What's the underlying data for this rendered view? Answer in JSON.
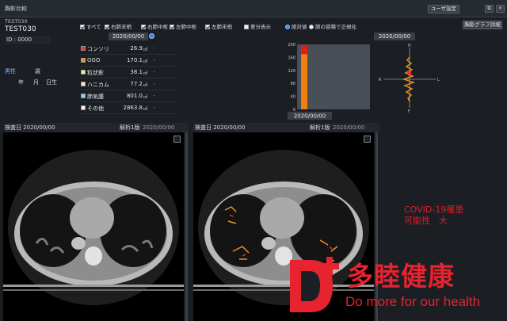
{
  "window": {
    "title": "胸影比較",
    "user_settings_label": "ユーザ設定",
    "restore_glyph": "⧉",
    "close_glyph": "×"
  },
  "patient": {
    "code": "TEST030",
    "name": "TEST030",
    "id_label": "ID : 0000",
    "sex": "男性",
    "age_unit": "歳",
    "year_unit": "年",
    "month_unit": "月",
    "day_unit": "日生"
  },
  "filters": {
    "all": "すべて",
    "right_lower": "右肺末梢",
    "right_middle": "右肺中枢",
    "left_middle": "左肺中枢",
    "left_lower": "左肺末梢",
    "diff_display": "差分表示",
    "absolute": "絶対値",
    "normalize": "肺の容積で正規化"
  },
  "detail_graph_label": "胸影グラフ詳細",
  "left_panel": {
    "date": "2020/00/00"
  },
  "right_panel": {
    "date": "2020/00/00"
  },
  "findings": [
    {
      "label": "コンソリ",
      "value": "26.9",
      "unit": "㎤",
      "compare": "-",
      "color": "#e8322a"
    },
    {
      "label": "GGO",
      "value": "170.1",
      "unit": "㎤",
      "compare": "-",
      "color": "#f09020"
    },
    {
      "label": "粒状影",
      "value": "38.1",
      "unit": "㎤",
      "compare": "-",
      "color": "#f6ef8c"
    },
    {
      "label": "ハニカム",
      "value": "77.2",
      "unit": "㎤",
      "compare": "-",
      "color": "#f4f2c0"
    },
    {
      "label": "肺気腫",
      "value": "801.0",
      "unit": "㎤",
      "compare": "-",
      "color": "#86d4ea"
    },
    {
      "label": "その他",
      "value": "2863.8",
      "unit": "㎤",
      "compare": "-",
      "color": "#f2f2f2"
    }
  ],
  "chart_data": {
    "type": "bar",
    "categories": [
      "2020/00/00"
    ],
    "series": [
      {
        "values": [
          170.1
        ],
        "color": "#f07f12"
      },
      {
        "values": [
          26.9
        ],
        "color": "#e21c1c"
      }
    ],
    "stacked": true,
    "ylim": [
      0,
      200
    ],
    "yticks": [
      0,
      40,
      80,
      120,
      160,
      200
    ],
    "grid": false
  },
  "orientation": {
    "head": "H",
    "foot": "F",
    "right": "R",
    "left": "L"
  },
  "viewers": [
    {
      "exam_date": "検査日 2020/00/00",
      "analysis": "解析1版",
      "analysis_date": "2020/00/00"
    },
    {
      "exam_date": "検査日 2020/00/00",
      "analysis": "解析1版",
      "analysis_date": "2020/00/00"
    }
  ],
  "annotation": {
    "line1": "COVID-19罹患",
    "line2": "可能性　大"
  },
  "watermark": {
    "brand": "多睦健康",
    "slogan": "Do more for our health"
  }
}
